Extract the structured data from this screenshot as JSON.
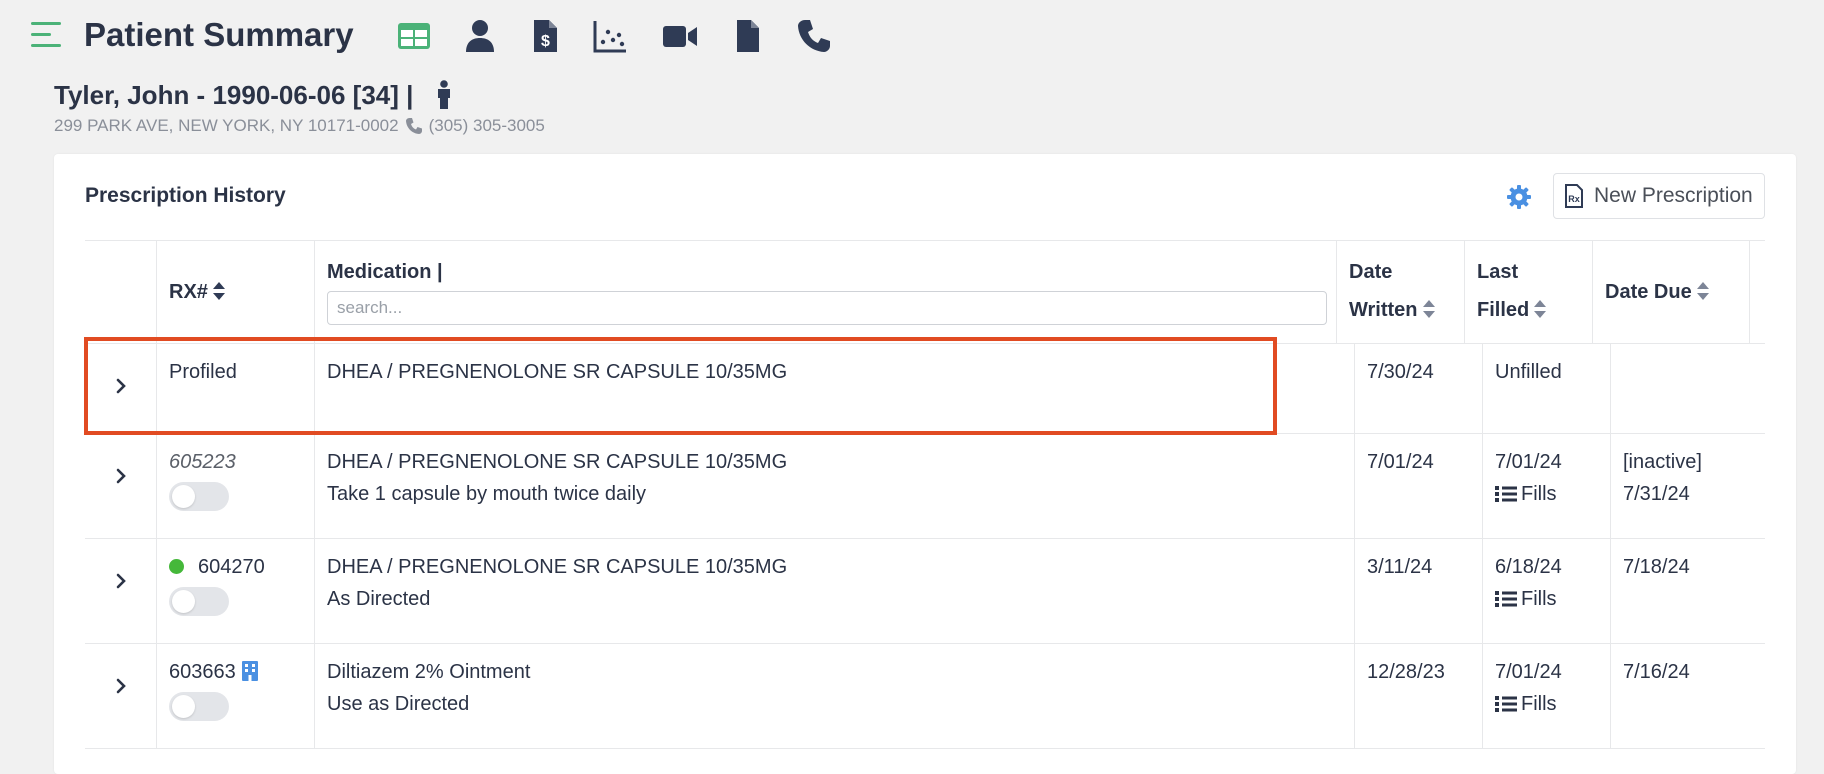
{
  "header": {
    "title": "Patient Summary",
    "icons": [
      "menu-icon",
      "table-icon",
      "user-icon",
      "invoice-icon",
      "chart-scatter-icon",
      "video-icon",
      "document-icon",
      "phone-icon"
    ],
    "accent_color": "#4bb278",
    "icon_color": "#2f3b55"
  },
  "patient": {
    "name_line": "Tyler, John - 1990-06-06 [34] |",
    "address": "299 PARK AVE, NEW YORK, NY 10171-0002",
    "phone": "(305) 305-3005"
  },
  "card": {
    "title": "Prescription History",
    "new_rx_label": "New Prescription"
  },
  "table": {
    "headers": {
      "rx": "RX#",
      "medication": "Medication |",
      "date_written_1": "Date",
      "date_written_2": "Written",
      "last_filled_1": "Last",
      "last_filled_2": "Filled",
      "date_due": "Date Due"
    },
    "search_placeholder": "search...",
    "fills_label": "Fills",
    "rows": [
      {
        "rx": "Profiled",
        "medication": "DHEA / PREGNENOLONE SR CAPSULE 10/35MG",
        "sig": "",
        "date_written": "7/30/24",
        "last_filled": "Unfilled",
        "due_1": "",
        "due_2": ""
      },
      {
        "rx": "605223",
        "medication": "DHEA / PREGNENOLONE SR CAPSULE 10/35MG",
        "sig": "Take 1 capsule by mouth twice daily",
        "date_written": "7/01/24",
        "last_filled": "7/01/24",
        "due_1": "[inactive]",
        "due_2": "7/31/24"
      },
      {
        "rx": "604270",
        "medication": "DHEA / PREGNENOLONE SR CAPSULE 10/35MG",
        "sig": "As Directed",
        "date_written": "3/11/24",
        "last_filled": "6/18/24",
        "due_1": "7/18/24",
        "due_2": ""
      },
      {
        "rx": "603663",
        "medication": "Diltiazem 2% Ointment",
        "sig": "Use as Directed",
        "date_written": "12/28/23",
        "last_filled": "7/01/24",
        "due_1": "7/16/24",
        "due_2": ""
      }
    ]
  },
  "colors": {
    "highlight": "#e14b22",
    "status_active": "#45b83a",
    "link_blue": "#4a90e2"
  }
}
